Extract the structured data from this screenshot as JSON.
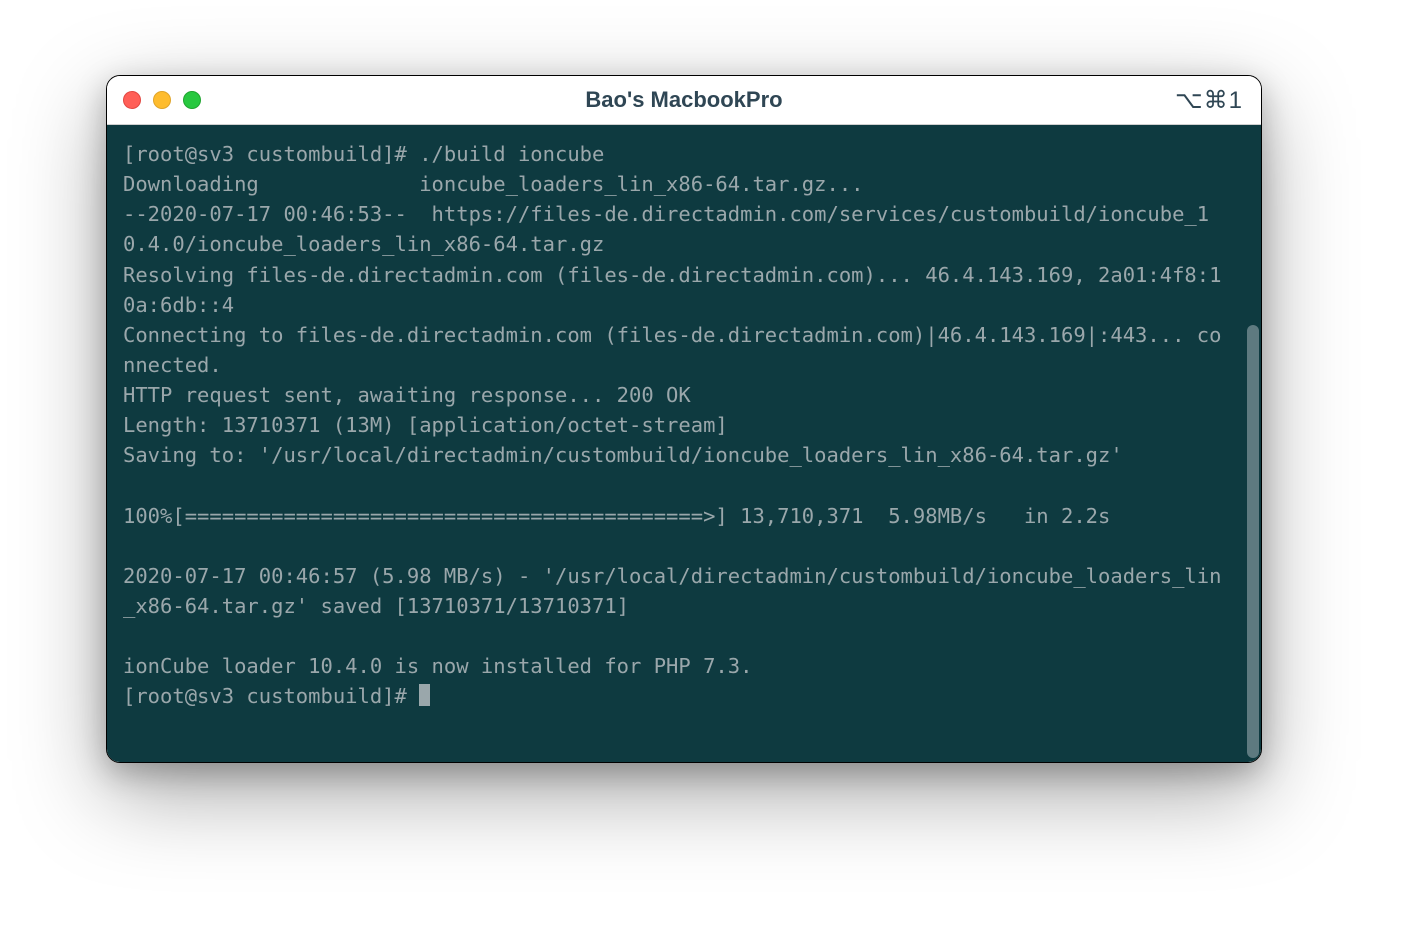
{
  "window": {
    "title": "Bao's MacbookPro",
    "shortcut": "⌥⌘1"
  },
  "traffic": {
    "close_name": "close-icon",
    "min_name": "minimize-icon",
    "max_name": "zoom-icon"
  },
  "terminal": {
    "lines": [
      "[root@sv3 custombuild]# ./build ioncube",
      "Downloading             ioncube_loaders_lin_x86-64.tar.gz...",
      "--2020-07-17 00:46:53--  https://files-de.directadmin.com/services/custombuild/ioncube_10.4.0/ioncube_loaders_lin_x86-64.tar.gz",
      "Resolving files-de.directadmin.com (files-de.directadmin.com)... 46.4.143.169, 2a01:4f8:10a:6db::4",
      "Connecting to files-de.directadmin.com (files-de.directadmin.com)|46.4.143.169|:443... connected.",
      "HTTP request sent, awaiting response... 200 OK",
      "Length: 13710371 (13M) [application/octet-stream]",
      "Saving to: '/usr/local/directadmin/custombuild/ioncube_loaders_lin_x86-64.tar.gz'",
      "",
      "100%[==========================================>] 13,710,371  5.98MB/s   in 2.2s",
      "",
      "2020-07-17 00:46:57 (5.98 MB/s) - '/usr/local/directadmin/custombuild/ioncube_loaders_lin_x86-64.tar.gz' saved [13710371/13710371]",
      "",
      "ionCube loader 10.4.0 is now installed for PHP 7.3."
    ],
    "prompt": "[root@sv3 custombuild]# "
  }
}
